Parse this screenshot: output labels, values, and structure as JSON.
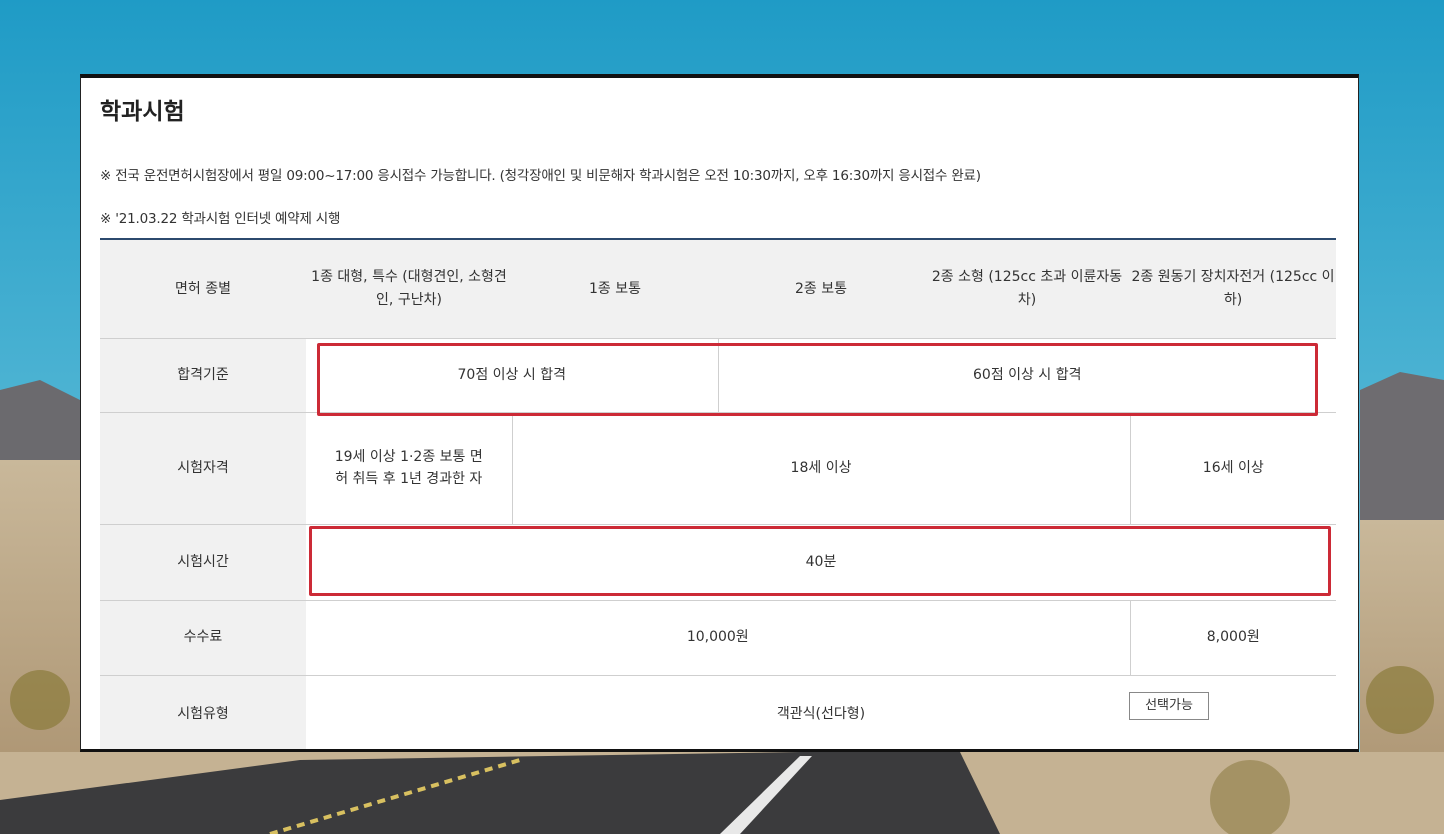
{
  "page": {
    "title": "학과시험",
    "notes": [
      "※ 전국 운전면허시험장에서 평일 09:00~17:00 응시접수 가능합니다. (청각장애인 및 비문해자 학과시험은 오전 10:30까지, 오후 16:30까지 응시접수 완료)",
      "※ '21.03.22 학과시험 인터넷 예약제 시행"
    ]
  },
  "table": {
    "headers": {
      "category": "면허 종별",
      "type1_large": "1종 대형, 특수 (대형견인, 소형견인, 구난차)",
      "type1_normal": "1종 보통",
      "type2_normal": "2종 보통",
      "type2_small": "2종 소형 (125cc 초과 이륜자동차)",
      "type2_moped": "2종 원동기 장치자전거 (125cc 이하)"
    },
    "rows": {
      "pass": {
        "label": "합격기준",
        "type1": "70점 이상 시 합격",
        "type2": "60점 이상 시 합격"
      },
      "qualification": {
        "label": "시험자격",
        "type1_large": "19세 이상 1·2종 보통 면허 취득 후 1년 경과한 자",
        "middle": "18세 이상",
        "moped": "16세 이상"
      },
      "time": {
        "label": "시험시간",
        "value": "40분"
      },
      "fee": {
        "label": "수수료",
        "main": "10,000원",
        "moped": "8,000원"
      },
      "type": {
        "label": "시험유형",
        "value": "객관식(선다형)",
        "badge": "선택가능"
      }
    }
  },
  "colors": {
    "highlight": "#cc2a36",
    "table_top_border": "#2c4a6e",
    "header_bg": "#f1f1f1"
  }
}
